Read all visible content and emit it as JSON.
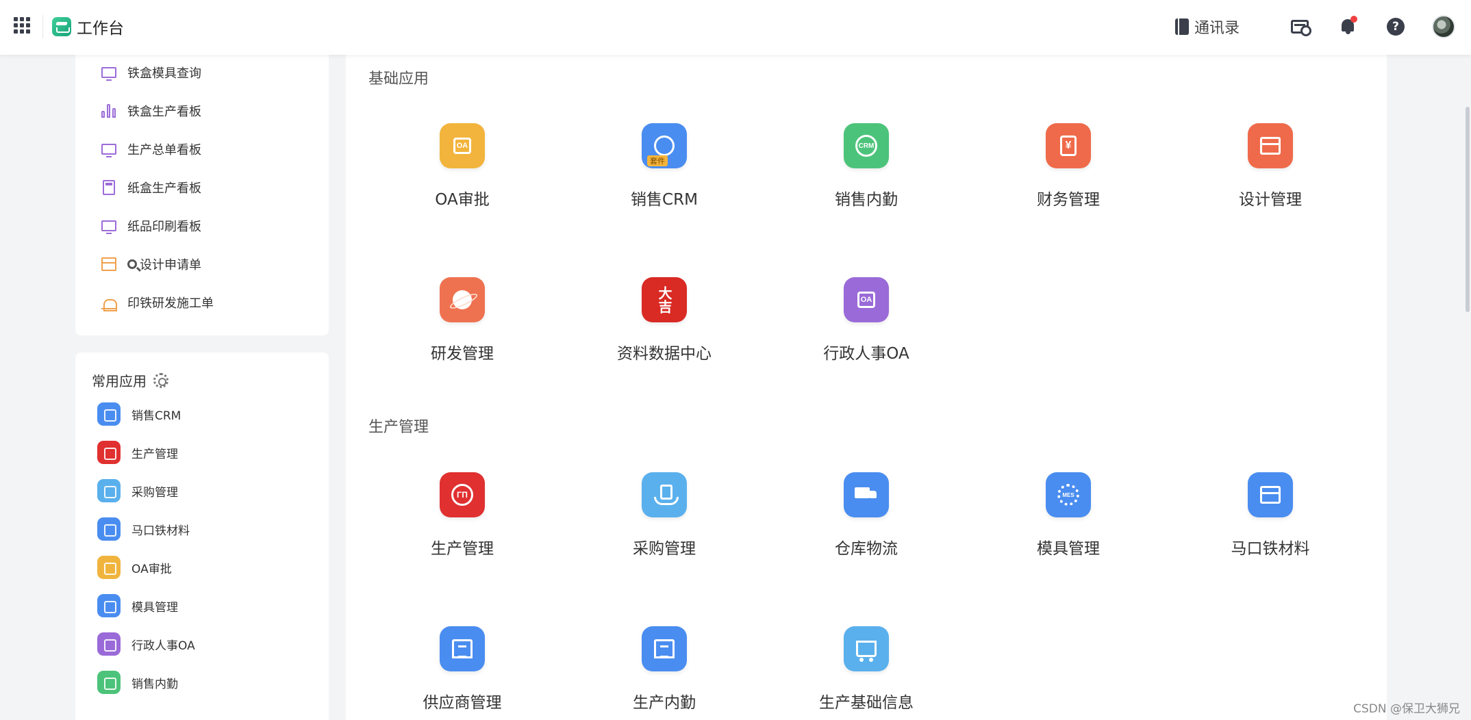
{
  "header": {
    "title": "工作台",
    "contacts_label": "通讯录"
  },
  "sidebar": {
    "boards": [
      {
        "label": "铁盒模具查询",
        "icon": "monitor-icon"
      },
      {
        "label": "铁盒生产看板",
        "icon": "bar-chart-icon"
      },
      {
        "label": "生产总单看板",
        "icon": "monitor-icon"
      },
      {
        "label": "纸盒生产看板",
        "icon": "calculator-icon"
      },
      {
        "label": "纸品印刷看板",
        "icon": "monitor-icon"
      },
      {
        "label": "设计申请单",
        "icon": "store-icon"
      },
      {
        "label": "印铁研发施工单",
        "icon": "alarm-icon"
      }
    ],
    "favorites_title": "常用应用",
    "favorites": [
      {
        "label": "销售CRM",
        "color": "#4a8df0"
      },
      {
        "label": "生产管理",
        "color": "#e03030"
      },
      {
        "label": "采购管理",
        "color": "#5ab0ec"
      },
      {
        "label": "马口铁材料",
        "color": "#4a8df0"
      },
      {
        "label": "OA审批",
        "color": "#f0b43e"
      },
      {
        "label": "模具管理",
        "color": "#4a8df0"
      },
      {
        "label": "行政人事OA",
        "color": "#9a6ad8"
      },
      {
        "label": "销售内勤",
        "color": "#4cc37a"
      }
    ]
  },
  "sections": [
    {
      "title": "基础应用",
      "apps": [
        {
          "label": "OA审批",
          "icon": "oa-icon",
          "color": "#f2b43c"
        },
        {
          "label": "销售CRM",
          "icon": "crm-suite-icon",
          "color": "#4a8df0",
          "badge": "套件"
        },
        {
          "label": "销售内勤",
          "icon": "crm-icon",
          "color": "#4cc37a"
        },
        {
          "label": "财务管理",
          "icon": "yen-icon",
          "color": "#ef6a4a"
        },
        {
          "label": "设计管理",
          "icon": "store-icon",
          "color": "#ef6a4a"
        },
        {
          "label": "研发管理",
          "icon": "planet-icon",
          "color": "#ef7250"
        },
        {
          "label": "资料数据中心",
          "icon": "daji-logo-icon",
          "color": "#d92a24"
        },
        {
          "label": "行政人事OA",
          "icon": "oa-icon",
          "color": "#9a6ad8"
        }
      ]
    },
    {
      "title": "生产管理",
      "apps": [
        {
          "label": "生产管理",
          "icon": "production-logo-icon",
          "color": "#e03030"
        },
        {
          "label": "采购管理",
          "icon": "hand-bag-icon",
          "color": "#5ab0ec"
        },
        {
          "label": "仓库物流",
          "icon": "truck-icon",
          "color": "#4a8df0"
        },
        {
          "label": "模具管理",
          "icon": "mes-gear-icon",
          "color": "#4a8df0"
        },
        {
          "label": "马口铁材料",
          "icon": "shop-icon",
          "color": "#4a8df0"
        },
        {
          "label": "供应商管理",
          "icon": "building-icon",
          "color": "#4a8df0"
        },
        {
          "label": "生产内勤",
          "icon": "building-icon",
          "color": "#4a8df0"
        },
        {
          "label": "生产基础信息",
          "icon": "cart-icon",
          "color": "#5ab0ec"
        }
      ]
    }
  ],
  "icon_texts": {
    "oa": "OA",
    "crm": "CRM",
    "yen": "¥",
    "daji": "大吉",
    "production": "ΓΠ",
    "mes": "MES"
  },
  "watermark": "CSDN @保卫大狮兄"
}
